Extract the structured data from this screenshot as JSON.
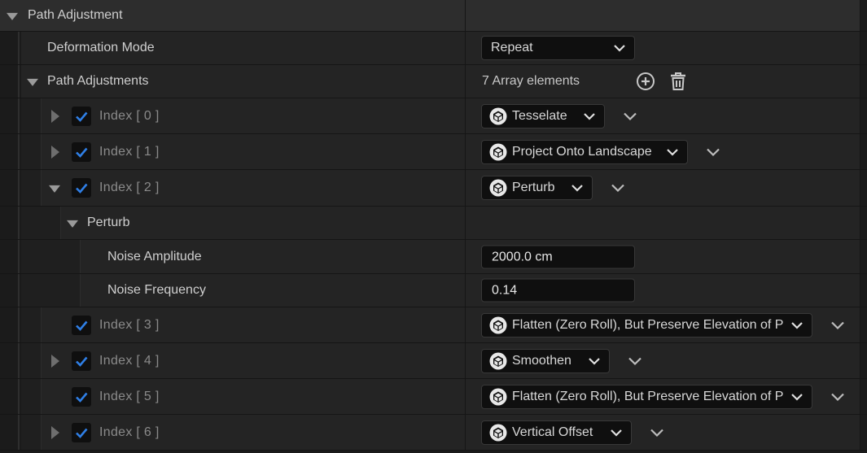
{
  "section": {
    "title": "Path Adjustment"
  },
  "deformation_mode": {
    "label": "Deformation Mode",
    "value": "Repeat"
  },
  "path_adjustments": {
    "label": "Path Adjustments",
    "count_text": "7 Array elements"
  },
  "elements": [
    {
      "index_label": "Index [ 0 ]",
      "value": "Tesselate",
      "checked": true,
      "expanded": false
    },
    {
      "index_label": "Index [ 1 ]",
      "value": "Project Onto Landscape",
      "checked": true,
      "expanded": false
    },
    {
      "index_label": "Index [ 2 ]",
      "value": "Perturb",
      "checked": true,
      "expanded": true
    },
    {
      "index_label": "Index [ 3 ]",
      "value": "Flatten (Zero Roll), But Preserve Elevation of P",
      "checked": true,
      "expanded": false
    },
    {
      "index_label": "Index [ 4 ]",
      "value": "Smoothen",
      "checked": true,
      "expanded": false
    },
    {
      "index_label": "Index [ 5 ]",
      "value": "Flatten (Zero Roll), But Preserve Elevation of P",
      "checked": true,
      "expanded": false
    },
    {
      "index_label": "Index [ 6 ]",
      "value": "Vertical Offset",
      "checked": true,
      "expanded": false
    }
  ],
  "perturb": {
    "label": "Perturb",
    "noise_amplitude": {
      "label": "Noise Amplitude",
      "value": "2000.0 cm"
    },
    "noise_frequency": {
      "label": "Noise Frequency",
      "value": "0.14"
    }
  },
  "colors": {
    "accent": "#2f7fe6",
    "background": "#242424",
    "header": "#2d2d2d"
  },
  "icons": [
    "expand-arrow-icon",
    "checkbox-check-icon",
    "cube-icon",
    "chevron-down-icon",
    "add-element-icon",
    "delete-trash-icon"
  ]
}
